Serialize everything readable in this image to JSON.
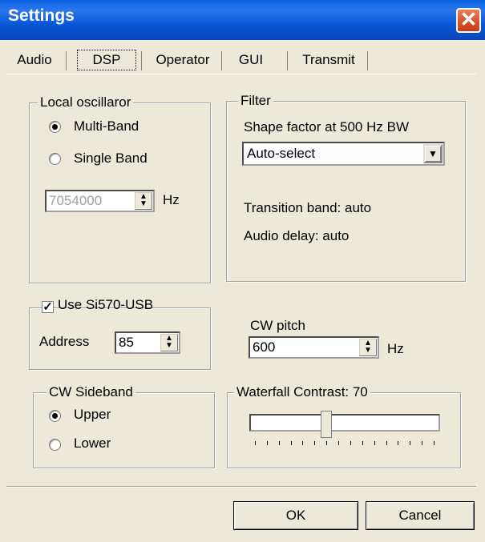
{
  "window": {
    "title": "Settings"
  },
  "tabs": [
    "Audio",
    "DSP",
    "Operator",
    "GUI",
    "Transmit"
  ],
  "local_oscillator": {
    "legend": "Local oscillaror",
    "options": [
      "Multi-Band",
      "Single Band"
    ],
    "selected": "Multi-Band",
    "frequency_value": "7054000",
    "frequency_unit": "Hz"
  },
  "filter": {
    "legend": "Filter",
    "shape_factor_label": "Shape factor at 500 Hz BW",
    "shape_factor_value": "Auto-select",
    "transition_band": "Transition band: auto",
    "audio_delay": "Audio delay: auto"
  },
  "si570": {
    "checkbox_label": "Use Si570-USB",
    "checked": true,
    "address_label": "Address",
    "address_value": "85"
  },
  "cw_pitch": {
    "label": "CW pitch",
    "value": "600",
    "unit": "Hz"
  },
  "cw_sideband": {
    "legend": "CW Sideband",
    "options": [
      "Upper",
      "Lower"
    ],
    "selected": "Upper"
  },
  "waterfall": {
    "legend": "Waterfall Contrast: 70",
    "value": 70
  },
  "buttons": {
    "ok": "OK",
    "cancel": "Cancel"
  },
  "colors": {
    "titlebar": "#0857d8",
    "close": "#d4502a",
    "face": "#ece9d8"
  }
}
